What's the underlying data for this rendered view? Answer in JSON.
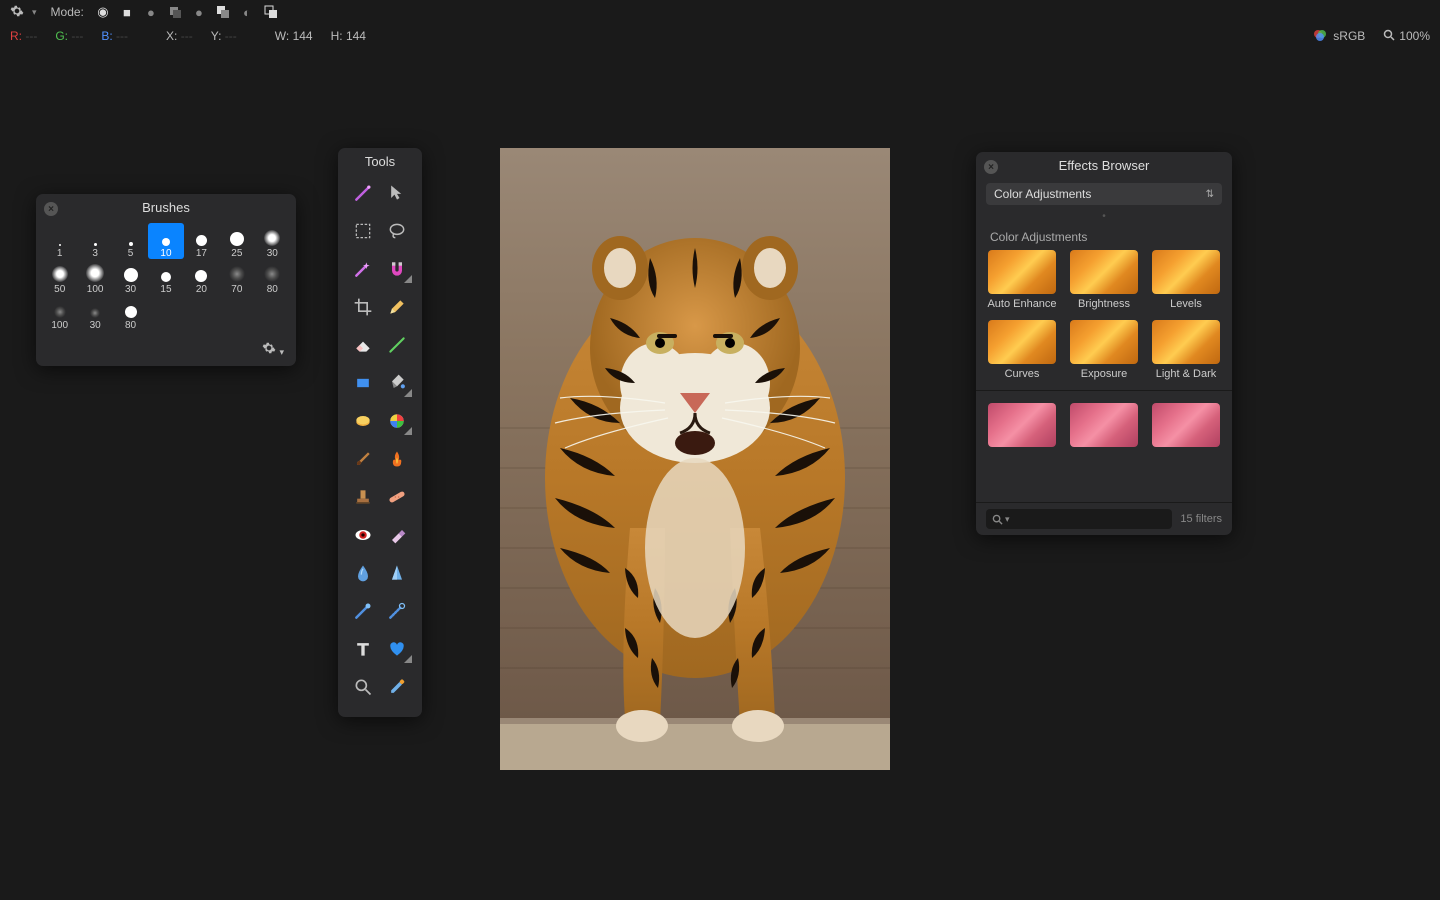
{
  "topbar": {
    "mode_label": "Mode:"
  },
  "infobar": {
    "r_label": "R:",
    "g_label": "G:",
    "b_label": "B:",
    "dash": "---",
    "x_label": "X:",
    "y_label": "Y:",
    "w_label": "W:",
    "w_val": "144",
    "h_label": "H:",
    "h_val": "144",
    "colorspace": "sRGB",
    "zoom": "100%"
  },
  "brushes": {
    "title": "Brushes",
    "items": [
      {
        "size": "1",
        "d": 2,
        "t": "dot"
      },
      {
        "size": "3",
        "d": 3,
        "t": "dot"
      },
      {
        "size": "5",
        "d": 4,
        "t": "dot"
      },
      {
        "size": "10",
        "d": 8,
        "t": "dot",
        "sel": true
      },
      {
        "size": "17",
        "d": 11,
        "t": "dot"
      },
      {
        "size": "25",
        "d": 14,
        "t": "dot"
      },
      {
        "size": "30",
        "d": 16,
        "t": "soft"
      },
      {
        "size": "50",
        "d": 16,
        "t": "soft"
      },
      {
        "size": "100",
        "d": 18,
        "t": "soft"
      },
      {
        "size": "30",
        "d": 14,
        "t": "dot"
      },
      {
        "size": "15",
        "d": 10,
        "t": "dot"
      },
      {
        "size": "20",
        "d": 12,
        "t": "dot"
      },
      {
        "size": "70",
        "d": 16,
        "t": "tex"
      },
      {
        "size": "80",
        "d": 16,
        "t": "tex"
      },
      {
        "size": "100",
        "d": 12,
        "t": "tex"
      },
      {
        "size": "30",
        "d": 10,
        "t": "tex"
      },
      {
        "size": "80",
        "d": 12,
        "t": "dot"
      }
    ]
  },
  "tools": {
    "title": "Tools",
    "items": [
      {
        "name": "wand",
        "sub": false
      },
      {
        "name": "arrow",
        "sub": false
      },
      {
        "name": "marquee",
        "sub": false
      },
      {
        "name": "lasso",
        "sub": false
      },
      {
        "name": "magic-wand",
        "sub": false
      },
      {
        "name": "magnet",
        "sub": true
      },
      {
        "name": "crop",
        "sub": false
      },
      {
        "name": "pencil",
        "sub": false
      },
      {
        "name": "eraser",
        "sub": false
      },
      {
        "name": "line",
        "sub": false
      },
      {
        "name": "rectangle",
        "sub": false
      },
      {
        "name": "bucket",
        "sub": true
      },
      {
        "name": "sponge",
        "sub": false
      },
      {
        "name": "color-wheel",
        "sub": true
      },
      {
        "name": "brush",
        "sub": false
      },
      {
        "name": "flame",
        "sub": false
      },
      {
        "name": "stamp",
        "sub": false
      },
      {
        "name": "bandaid",
        "sub": false
      },
      {
        "name": "redeye",
        "sub": false
      },
      {
        "name": "smudge-eraser",
        "sub": false
      },
      {
        "name": "blur",
        "sub": false
      },
      {
        "name": "sharpen",
        "sub": false
      },
      {
        "name": "dodge",
        "sub": false
      },
      {
        "name": "burn",
        "sub": false
      },
      {
        "name": "text",
        "sub": false
      },
      {
        "name": "shape",
        "sub": true
      },
      {
        "name": "zoom",
        "sub": false
      },
      {
        "name": "eyedropper",
        "sub": false
      }
    ]
  },
  "effects": {
    "title": "Effects Browser",
    "dropdown": "Color Adjustments",
    "section": "Color Adjustments",
    "row1": [
      {
        "label": "Auto Enhance",
        "c": "orange"
      },
      {
        "label": "Brightness",
        "c": "orange"
      },
      {
        "label": "Levels",
        "c": "orange"
      }
    ],
    "row2": [
      {
        "label": "Curves",
        "c": "orange"
      },
      {
        "label": "Exposure",
        "c": "orange"
      },
      {
        "label": "Light & Dark",
        "c": "orange"
      }
    ],
    "row3": [
      {
        "label": "",
        "c": "pink"
      },
      {
        "label": "",
        "c": "pink"
      },
      {
        "label": "",
        "c": "pink"
      }
    ],
    "filter_count": "15 filters"
  }
}
